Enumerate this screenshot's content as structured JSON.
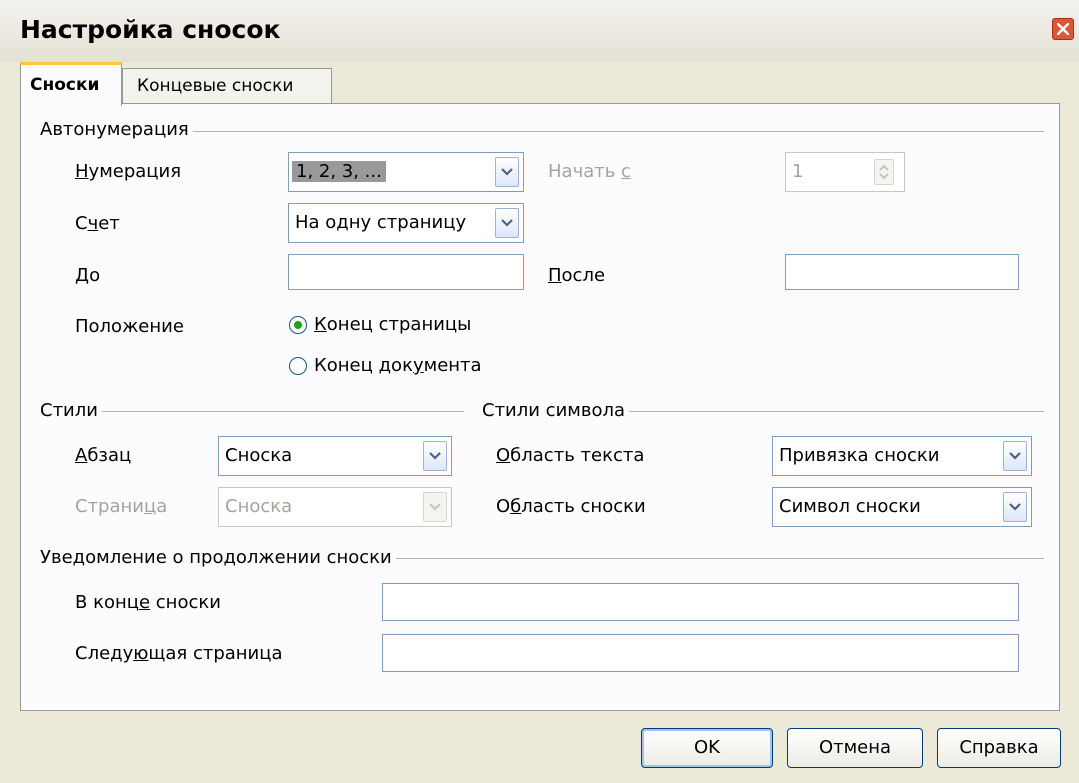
{
  "window": {
    "title": "Настройка сносок"
  },
  "tabs": [
    {
      "label": "Сноски",
      "active": true
    },
    {
      "label": "Концевые сноски",
      "active": false
    }
  ],
  "autonum": {
    "section": "Автонумерация",
    "numbering_label": "Нумерация",
    "numbering_value": "1, 2, 3, ...",
    "start_label": "Начать с",
    "start_value": "1",
    "counting_label": "Счет",
    "counting_value": "На одну страницу",
    "before_label": "До",
    "before_value": "",
    "after_label": "После",
    "after_value": "",
    "position_label": "Положение",
    "pos_page_end": "Конец страницы",
    "pos_doc_end": "Конец документа",
    "selected_position": "Конец страницы"
  },
  "styles": {
    "section": "Стили",
    "paragraph_label": "Абзац",
    "paragraph_value": "Сноска",
    "page_label": "Страница",
    "page_value": "Сноска"
  },
  "char_styles": {
    "section": "Стили символа",
    "text_area_label": "Область текста",
    "text_area_value": "Привязка сноски",
    "footnote_area_label": "Область сноски",
    "footnote_area_value": "Символ сноски"
  },
  "continuation": {
    "section": "Уведомление о продолжении сноски",
    "end_label": "В конце сноски",
    "end_value": "",
    "next_label": "Следующая страница",
    "next_value": ""
  },
  "buttons": {
    "ok": "OK",
    "cancel": "Отмена",
    "help": "Справка"
  },
  "colors": {
    "background": "#ece9d8",
    "tab_highlight": "#ffc83c",
    "radio_selected": "#21a121",
    "disabled_text": "#a6a39a"
  }
}
